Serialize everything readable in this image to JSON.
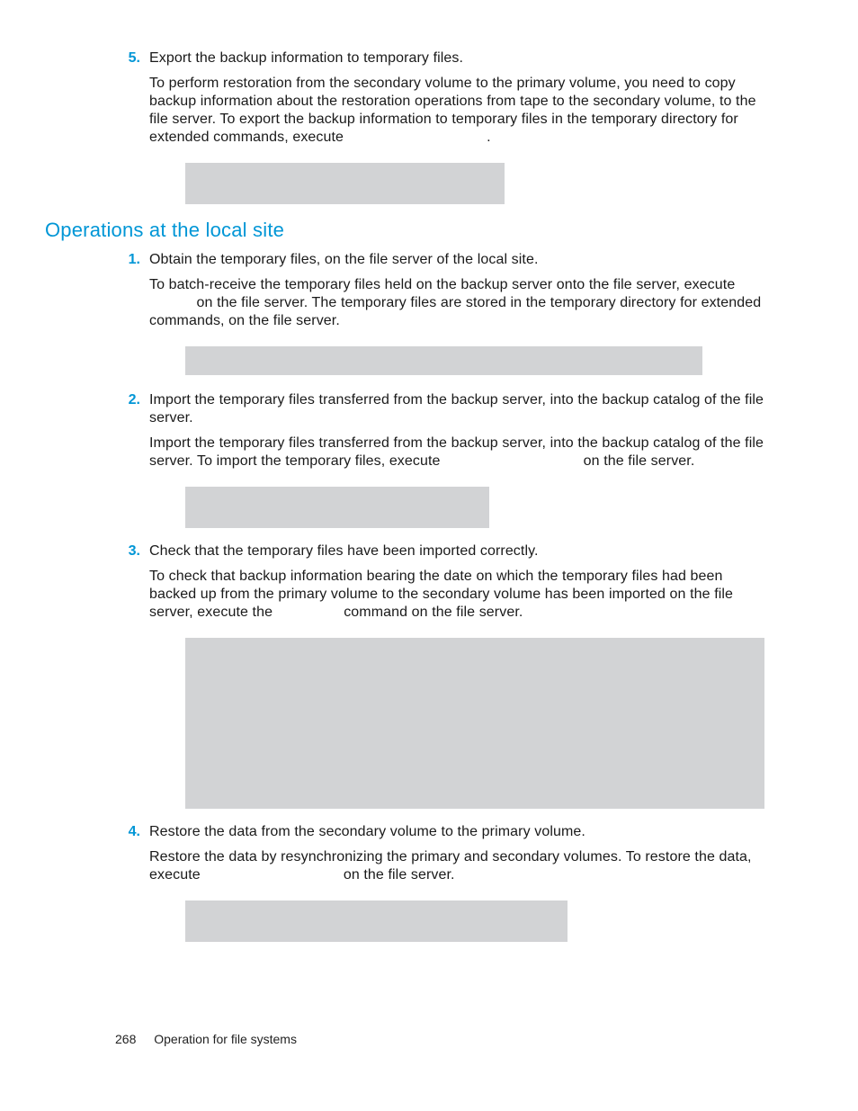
{
  "top": {
    "step5": {
      "num": "5.",
      "title": "Export the backup information to temporary files.",
      "para": "To perform restoration from the secondary volume to the primary volume, you need to copy backup information about the restoration operations from tape to the secondary volume, to the file server. To export the backup information to temporary files in the temporary directory for extended commands, execute",
      "trail": "."
    }
  },
  "heading": "Operations at the local site",
  "local": {
    "step1": {
      "num": "1.",
      "title": "Obtain the temporary files, on the file server of the local site.",
      "para1a": "To batch-receive the temporary files held on the backup server onto the file server, execute",
      "para1b": "on the file server. The temporary files are stored in the temporary directory for extended commands, on the file server."
    },
    "step2": {
      "num": "2.",
      "title": "Import the temporary files transferred from the backup server, into the backup catalog of the file server.",
      "para_a": "Import the temporary files transferred from the backup server, into the backup catalog of the file server. To import the temporary files, execute",
      "para_b": "on the file server."
    },
    "step3": {
      "num": "3.",
      "title": "Check that the temporary files have been imported correctly.",
      "para_a": "To check that backup information bearing the date on which the temporary files had been backed up from the primary volume to the secondary volume has been imported on the file server, execute the",
      "para_b": "command on the file server."
    },
    "step4": {
      "num": "4.",
      "title": "Restore the data from the secondary volume to the primary volume.",
      "para_a": "Restore the data by resynchronizing the primary and secondary volumes. To restore the data, execute",
      "para_b": "on the file server."
    }
  },
  "footer": {
    "page": "268",
    "section": "Operation for file systems"
  }
}
